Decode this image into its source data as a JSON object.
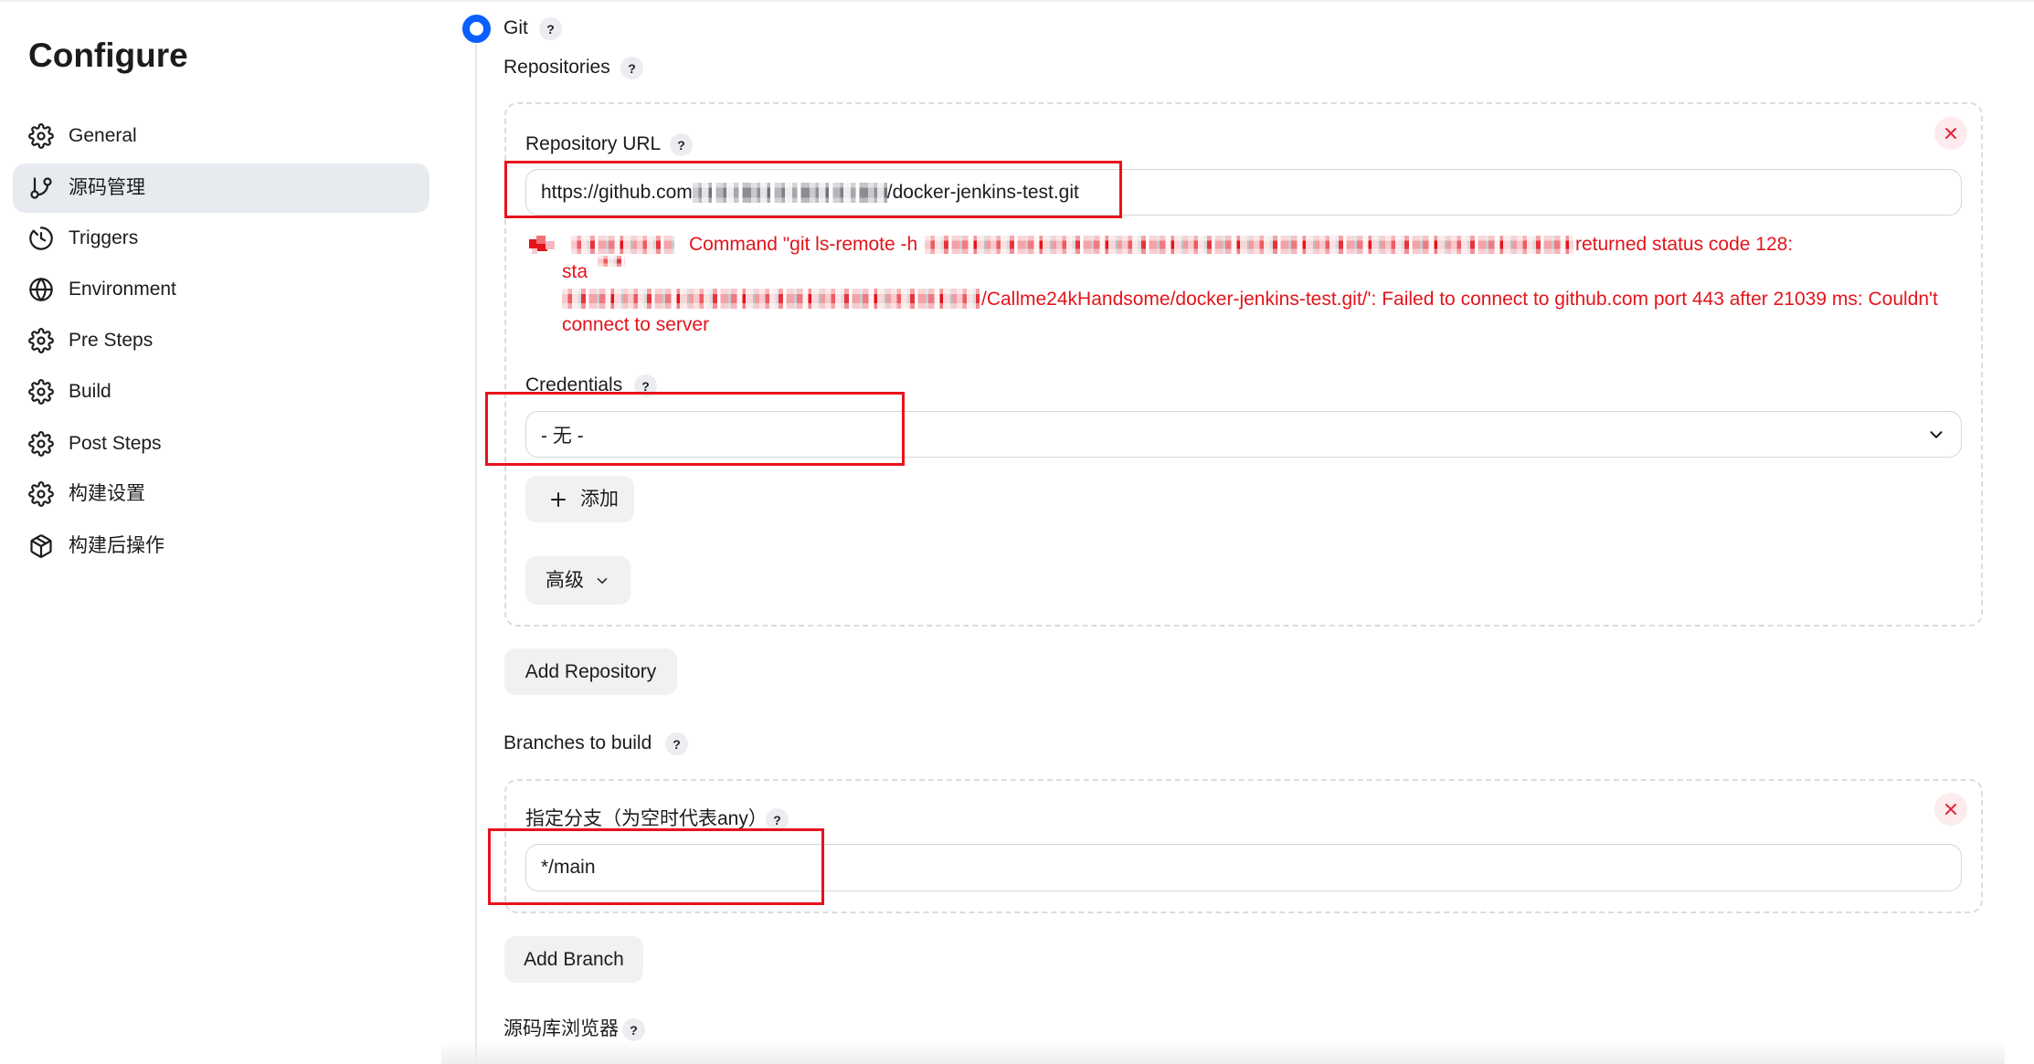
{
  "sidebar": {
    "title": "Configure",
    "items": [
      {
        "label": "General",
        "icon": "gear-icon",
        "active": false
      },
      {
        "label": "源码管理",
        "icon": "git-branch-icon",
        "active": true
      },
      {
        "label": "Triggers",
        "icon": "clock-icon",
        "active": false
      },
      {
        "label": "Environment",
        "icon": "globe-icon",
        "active": false
      },
      {
        "label": "Pre Steps",
        "icon": "gear-icon",
        "active": false
      },
      {
        "label": "Build",
        "icon": "gear-icon",
        "active": false
      },
      {
        "label": "Post Steps",
        "icon": "gear-icon",
        "active": false
      },
      {
        "label": "构建设置",
        "icon": "gear-icon",
        "active": false
      },
      {
        "label": "构建后操作",
        "icon": "package-icon",
        "active": false
      }
    ]
  },
  "scm": {
    "help_glyph": "?",
    "git": {
      "label": "Git",
      "selected": true
    },
    "repositories": {
      "label": "Repositories",
      "url": {
        "label": "Repository URL",
        "value_start": "https://github.com",
        "value_end": "/docker-jenkins-test.git"
      },
      "error": {
        "command": "Command \"git ls-remote -h",
        "status": "returned status code 128:",
        "line2": "sta",
        "line3": "/Callme24kHandsome/docker-jenkins-test.git/': Failed to connect to github.com port 443 after 21039 ms: Couldn't",
        "line4": "connect to server"
      },
      "credentials": {
        "label": "Credentials",
        "selected": "- 无 -",
        "add_label": "添加"
      },
      "advanced_label": "高级",
      "add_repository_label": "Add Repository"
    },
    "branches": {
      "label": "Branches to build",
      "specifier_label": "指定分支（为空时代表any）",
      "specifier_value": "*/main",
      "add_branch_label": "Add Branch"
    },
    "repository_browser": {
      "label": "源码库浏览器"
    }
  },
  "colors": {
    "accent": "#0b5fff",
    "error": "#e3141b",
    "annotation": "#e8121b",
    "remove": "#e5243b"
  }
}
